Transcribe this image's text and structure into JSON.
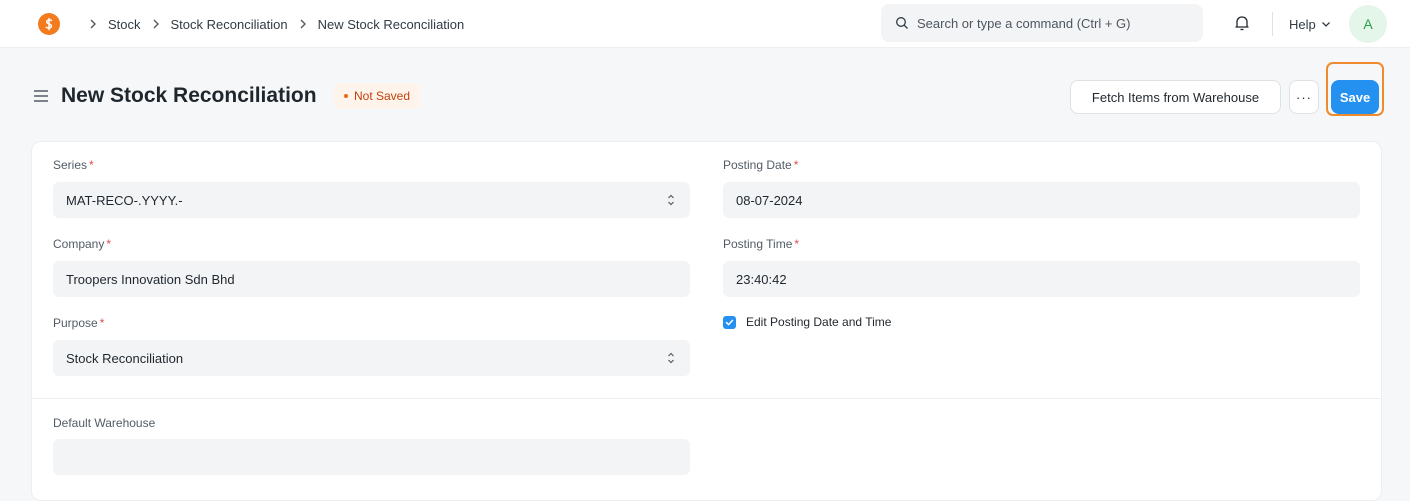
{
  "breadcrumb": [
    "Stock",
    "Stock Reconciliation",
    "New Stock Reconciliation"
  ],
  "search": {
    "placeholder": "Search or type a command (Ctrl + G)"
  },
  "nav": {
    "help_label": "Help",
    "avatar_initial": "A"
  },
  "page": {
    "title": "New Stock Reconciliation",
    "status": "Not Saved"
  },
  "actions": {
    "fetch_label": "Fetch Items from Warehouse",
    "more_label": "···",
    "save_label": "Save"
  },
  "form": {
    "series": {
      "label": "Series",
      "value": "MAT-RECO-.YYYY.-"
    },
    "company": {
      "label": "Company",
      "value": "Troopers Innovation Sdn Bhd"
    },
    "purpose": {
      "label": "Purpose",
      "value": "Stock Reconciliation"
    },
    "posting_date": {
      "label": "Posting Date",
      "value": "08-07-2024"
    },
    "posting_time": {
      "label": "Posting Time",
      "value": "23:40:42"
    },
    "edit_posting": {
      "label": "Edit Posting Date and Time",
      "checked": true
    },
    "default_warehouse": {
      "label": "Default Warehouse",
      "value": ""
    }
  },
  "colors": {
    "primary": "#2490ef",
    "logo": "#f37b1d",
    "status": "#c2410c",
    "highlight": "#f08a2f"
  },
  "icons": [
    "app-logo-icon",
    "chevron-right-icon",
    "search-icon",
    "bell-icon",
    "chevron-down-icon",
    "hamburger-icon",
    "select-arrows-icon",
    "check-icon"
  ]
}
